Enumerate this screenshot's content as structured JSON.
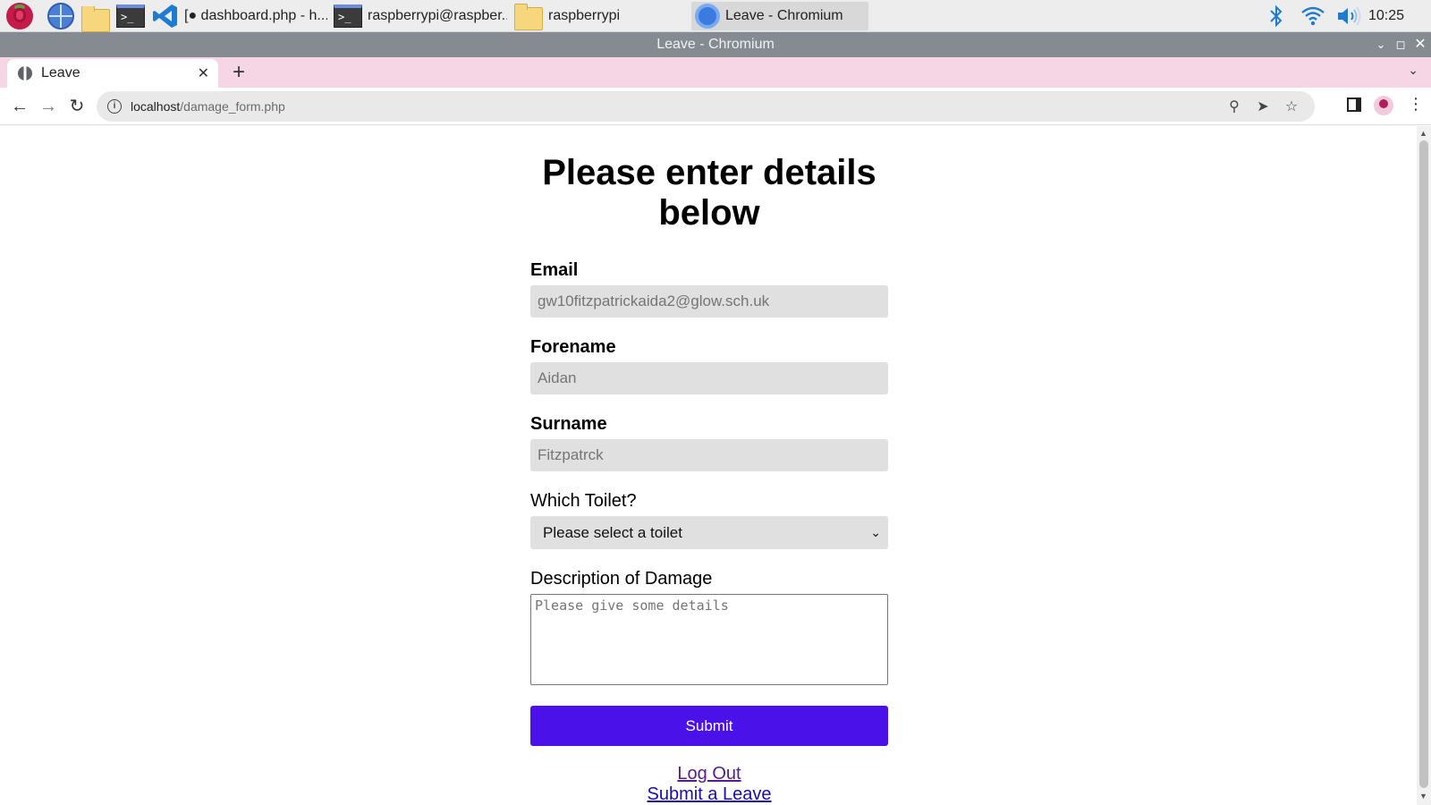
{
  "taskbar": {
    "items": [
      {
        "icon": "raspberry-pi-menu-icon",
        "label": ""
      },
      {
        "icon": "web-browser-icon",
        "label": ""
      },
      {
        "icon": "file-manager-icon",
        "label": ""
      },
      {
        "icon": "terminal-icon",
        "label": ""
      },
      {
        "icon": "vscode-icon",
        "label": "[● dashboard.php - h..."
      },
      {
        "icon": "terminal-icon",
        "label": "raspberrypi@raspber..."
      },
      {
        "icon": "folder-icon",
        "label": "raspberrypi"
      },
      {
        "icon": "chromium-icon",
        "label": "Leave - Chromium"
      }
    ],
    "tray": {
      "bluetooth_icon": "bluetooth-icon",
      "wifi_icon": "wifi-icon",
      "volume_icon": "volume-icon",
      "clock": "10:25"
    }
  },
  "window": {
    "title": "Leave - Chromium"
  },
  "browser": {
    "tab": {
      "title": "Leave"
    },
    "url_host": "localhost",
    "url_path": "/damage_form.php"
  },
  "form": {
    "heading": "Please enter details below",
    "email": {
      "label": "Email",
      "value": "gw10fitzpatrickaida2@glow.sch.uk"
    },
    "forename": {
      "label": "Forename",
      "value": "Aidan"
    },
    "surname": {
      "label": "Surname",
      "value": "Fitzpatrck"
    },
    "toilet": {
      "label": "Which Toilet?",
      "selected": "Please select a toilet"
    },
    "description": {
      "label": "Description of Damage",
      "placeholder": "Please give some details"
    },
    "submit_label": "Submit",
    "links": {
      "logout": "Log Out",
      "submit_leave": "Submit a Leave"
    }
  },
  "colors": {
    "accent_button": "#4a12e8",
    "tab_strip": "#f6d6e4",
    "title_bar": "#868b91"
  }
}
